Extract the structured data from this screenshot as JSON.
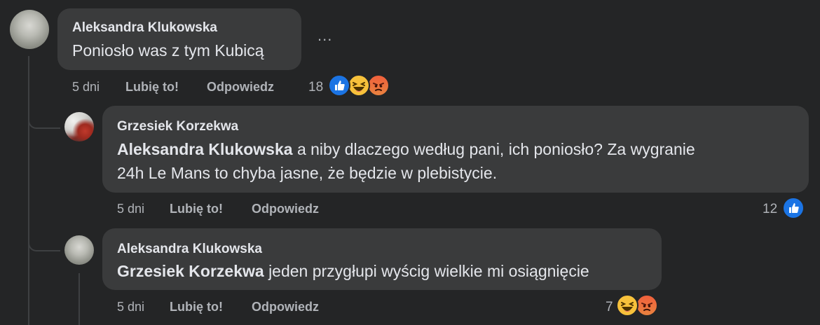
{
  "comments": [
    {
      "author": "Aleksandra Klukowska",
      "mention": "",
      "text": "Poniosło was z tym Kubicą",
      "time": "5 dni",
      "like_label": "Lubię to!",
      "reply_label": "Odpowiedz",
      "reaction_count": "18",
      "reactions": [
        "like-icon",
        "haha-icon",
        "angry-icon"
      ],
      "more_label": "..."
    },
    {
      "author": "Grzesiek Korzekwa",
      "mention": "Aleksandra Klukowska",
      "text_line1": "a niby dlaczego według pani, ich poniosło? Za wygranie",
      "text_line2": "24h Le Mans to chyba jasne, że będzie w plebistycie.",
      "time": "5 dni",
      "like_label": "Lubię to!",
      "reply_label": "Odpowiedz",
      "reaction_count": "12",
      "reactions": [
        "like-icon"
      ]
    },
    {
      "author": "Aleksandra Klukowska",
      "mention": "Grzesiek Korzekwa",
      "text": "jeden przygłupi wyścig wielkie mi osiągnięcie",
      "time": "5 dni",
      "like_label": "Lubię to!",
      "reply_label": "Odpowiedz",
      "reaction_count": "7",
      "reactions": [
        "haha-icon",
        "angry-icon"
      ]
    }
  ],
  "colors": {
    "background": "#242526",
    "bubble": "#3a3b3c",
    "text": "#e4e6eb",
    "secondary": "#b0b3b8",
    "like_blue": "#1b74e4",
    "thread_line": "#3e4042"
  }
}
